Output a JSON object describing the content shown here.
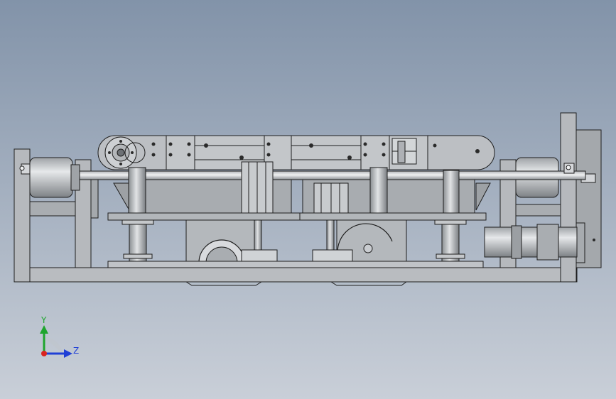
{
  "viewport": {
    "background_top": "#8293a9",
    "background_bottom": "#c9cfd8"
  },
  "model": {
    "metal_fill": "#b6b9bd",
    "metal_dark": "#8c8f93",
    "edge_color": "#1e1e1e"
  },
  "triad": {
    "y_label": "Y",
    "z_label": "Z",
    "y_color": "#1ea52d",
    "z_color": "#1f3fd6",
    "x_color": "#d9231f"
  }
}
